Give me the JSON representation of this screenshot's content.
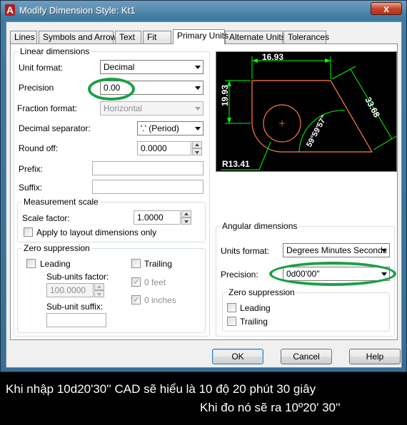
{
  "window": {
    "title": "Modify Dimension Style: Kt1",
    "app_icon": "A",
    "close_glyph": "x"
  },
  "tabs": [
    {
      "label": "Lines"
    },
    {
      "label": "Symbols and Arrows"
    },
    {
      "label": "Text"
    },
    {
      "label": "Fit"
    },
    {
      "label": "Primary Units",
      "active": true
    },
    {
      "label": "Alternate Units"
    },
    {
      "label": "Tolerances"
    }
  ],
  "linear": {
    "title": "Linear dimensions",
    "unit_format_label": "Unit format:",
    "unit_format_value": "Decimal",
    "precision_label": "Precision",
    "precision_value": "0.00",
    "fraction_format_label": "Fraction format:",
    "fraction_format_value": "Horizontal",
    "decimal_separator_label": "Decimal separator:",
    "decimal_separator_value": "'.' (Period)",
    "round_off_label": "Round off:",
    "round_off_value": "0.0000",
    "prefix_label": "Prefix:",
    "prefix_value": "",
    "suffix_label": "Suffix:",
    "suffix_value": ""
  },
  "measurement": {
    "title": "Measurement scale",
    "scale_factor_label": "Scale factor:",
    "scale_factor_value": "1.0000",
    "apply_layout_label": "Apply to layout dimensions only",
    "apply_layout_checked": false
  },
  "zero_suppression": {
    "title": "Zero suppression",
    "leading_label": "Leading",
    "trailing_label": "Trailing",
    "sub_units_factor_label": "Sub-units factor:",
    "sub_units_factor_value": "100.0000",
    "feet_label": "0 feet",
    "inches_label": "0 inches",
    "sub_unit_suffix_label": "Sub-unit suffix:",
    "sub_unit_suffix_value": ""
  },
  "angular": {
    "title": "Angular dimensions",
    "units_format_label": "Units format:",
    "units_format_value": "Degrees Minutes Seconds",
    "precision_label": "Precision:",
    "precision_value": "0d00'00\"",
    "zero_title": "Zero suppression",
    "leading_label": "Leading",
    "trailing_label": "Trailing"
  },
  "preview": {
    "dim_top": "16.93",
    "dim_left": "19.93",
    "dim_right": "33.68",
    "dim_angle": "59°59'57\"",
    "dim_radius": "R13.41",
    "colors": {
      "background": "#000000",
      "dims": "#00ff00",
      "geometry": "#ff8040",
      "text": "#ffffff"
    }
  },
  "buttons": {
    "ok": "OK",
    "cancel": "Cancel",
    "help": "Help"
  },
  "caption": {
    "line1": "Khi nhập 10d20'30'' CAD sẽ hiểu là 10 độ 20 phút 30 giây",
    "line2": "Khi đo nó sẽ ra 10º20' 30''"
  },
  "colors": {
    "highlight_oval": "#1aa045",
    "titlebar": "#3a6f93",
    "close_button": "#c7432b"
  }
}
